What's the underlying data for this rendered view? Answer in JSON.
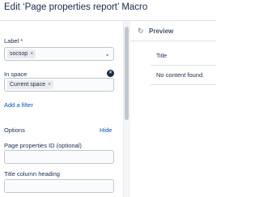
{
  "dialog": {
    "title": "Edit ‘Page properties report’ Macro"
  },
  "form": {
    "label_field": {
      "label": "Label *",
      "tags": [
        "socsop"
      ]
    },
    "space_field": {
      "label": "In space",
      "tags": [
        "Current space"
      ]
    },
    "add_filter": "Add a filter",
    "options": {
      "heading": "Options",
      "hide": "Hide"
    },
    "page_properties_id": {
      "label": "Page properties ID (optional)",
      "value": ""
    },
    "title_column_heading": {
      "label": "Title column heading",
      "value": ""
    }
  },
  "preview": {
    "label": "Preview",
    "table": {
      "header": "Title",
      "empty": "No content found."
    }
  },
  "icons": {
    "tag_remove": "close-icon",
    "select_arrow": "chevron-down-icon",
    "clear": "clear-icon",
    "refresh": "refresh-icon"
  },
  "colors": {
    "link": "#0052cc",
    "text": "#172b4d",
    "border": "#c1c7d0"
  }
}
